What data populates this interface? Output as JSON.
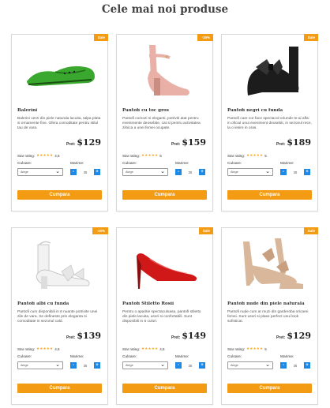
{
  "page": {
    "title": "Cele mai noi produse"
  },
  "labels": {
    "price": "Pret:",
    "rating": "Star rating:",
    "color": "Culoare:",
    "size": "Marime:",
    "buy": "Cumpara",
    "select_placeholder": "Alege"
  },
  "products": [
    {
      "badge": "Sale",
      "name": "Balerini",
      "description": "Balerini verzi din piele naturala lacuita, talpa plata si ornamente fine. Ofera comoditate pentru stilul tau de vara.",
      "price": "$129",
      "stars": "★★★★★",
      "rating": "4,5",
      "size": "35",
      "shoe_color": "#3aa82e",
      "icon": "flat-shoe-image"
    },
    {
      "badge": "-15%",
      "name": "Pantofi cu toc gros",
      "description": "Pantofi comozi si eleganti, potriviti atat pentru evenimente deosebite, cat si pentru activitatea zilnica a unei femei ocupate.",
      "price": "$159",
      "stars": "★★★★★",
      "rating": "5",
      "size": "35",
      "shoe_color": "#e8b0a6",
      "icon": "block-heel-image"
    },
    {
      "badge": "Sale",
      "name": "Pantofi negri cu funda",
      "description": "Pantofi care vor face spectacol oriunde te-ai afla: in oficiul unui eveniment deosebit, in sezonul rece, la o iesire in oras.",
      "price": "$189",
      "stars": "★★★★★",
      "rating": "5",
      "size": "35",
      "shoe_color": "#1c1c1c",
      "icon": "black-bow-heel-image"
    },
    {
      "badge": "-15%",
      "name": "Pantofi albi cu funda",
      "description": "Pantofi cum disponibili in 6 nuante potrivite unei zile de vara. Se defineste prin eleganta si comoditate in sezonul cald.",
      "price": "$139",
      "stars": "★★★★★",
      "rating": "4,5",
      "size": "35",
      "shoe_color": "#f2f2f2",
      "icon": "white-bow-heel-image"
    },
    {
      "badge": "Sale",
      "name": "Pantofi Stiletto Rosii",
      "description": "Pentru o aparitie spectaculoasa, pantofi stiletto din piele lacuita, usori si confortabili. Sunt disponibili in 6 culori.",
      "price": "$149",
      "stars": "★★★★★",
      "rating": "4,5",
      "size": "35",
      "shoe_color": "#d01818",
      "icon": "red-stiletto-image"
    },
    {
      "badge": "Sale",
      "name": "Pantofi nude din piele naturala",
      "description": "Pantofi nude cum ar muzi din garderoba oricarei femei. Sunt usori si plase perfect unui look sofisticat.",
      "price": "$129",
      "stars": "★★★★★",
      "rating": "5",
      "size": "35",
      "shoe_color": "#d9b79a",
      "icon": "nude-bow-heel-image"
    }
  ]
}
